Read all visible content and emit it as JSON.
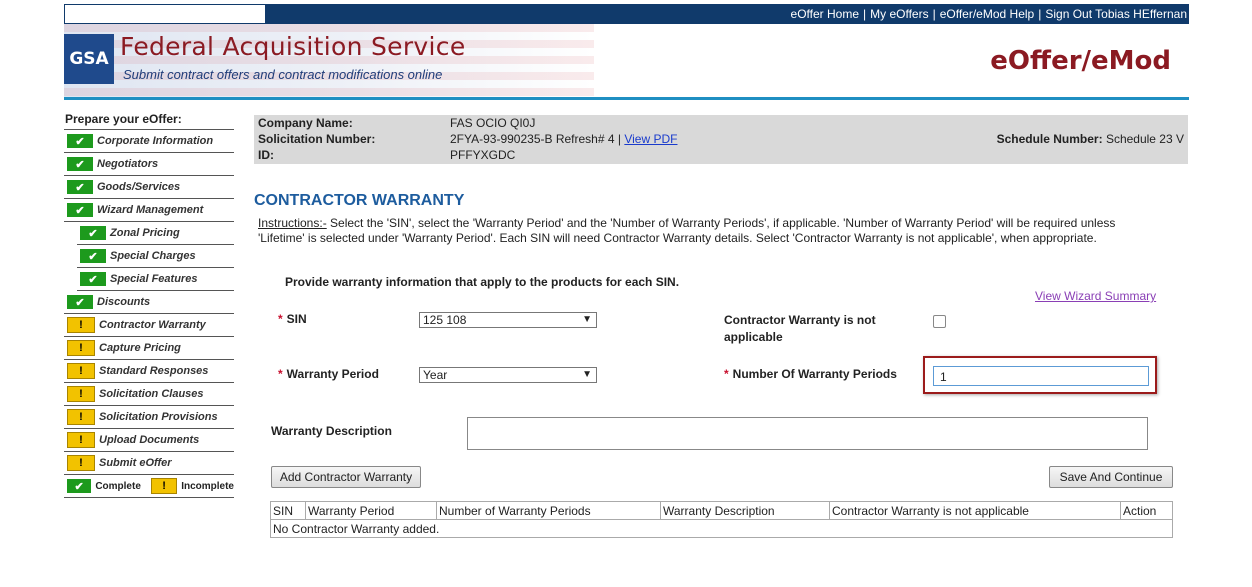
{
  "topnav": {
    "items": [
      "eOffer Home",
      "My eOffers",
      "eOffer/eMod Help",
      "Sign Out Tobias HEffernan"
    ]
  },
  "header": {
    "logo": "GSA",
    "title": "Federal Acquisition Service",
    "subtitle": "Submit contract offers and contract modifications online",
    "app_title": "eOffer/eMod"
  },
  "sidebar": {
    "title": "Prepare your eOffer:",
    "items": [
      {
        "label": "Corporate Information",
        "status": "complete",
        "sub": false
      },
      {
        "label": "Negotiators",
        "status": "complete",
        "sub": false
      },
      {
        "label": "Goods/Services",
        "status": "complete",
        "sub": false
      },
      {
        "label": "Wizard Management",
        "status": "complete",
        "sub": false
      },
      {
        "label": "Zonal Pricing",
        "status": "complete",
        "sub": true
      },
      {
        "label": "Special Charges",
        "status": "complete",
        "sub": true
      },
      {
        "label": "Special Features",
        "status": "complete",
        "sub": true
      },
      {
        "label": "Discounts",
        "status": "complete",
        "sub": false
      },
      {
        "label": "Contractor Warranty",
        "status": "incomplete",
        "sub": false
      },
      {
        "label": "Capture Pricing",
        "status": "incomplete",
        "sub": false
      },
      {
        "label": "Standard Responses",
        "status": "incomplete",
        "sub": false
      },
      {
        "label": "Solicitation Clauses",
        "status": "incomplete",
        "sub": false
      },
      {
        "label": "Solicitation Provisions",
        "status": "incomplete",
        "sub": false
      },
      {
        "label": "Upload Documents",
        "status": "incomplete",
        "sub": false
      },
      {
        "label": "Submit eOffer",
        "status": "incomplete",
        "sub": false
      }
    ],
    "legend": {
      "complete": "Complete",
      "incomplete": "Incomplete"
    }
  },
  "info": {
    "company_label": "Company Name:",
    "company_value": "FAS OCIO QI0J",
    "solicitation_label": "Solicitation Number:",
    "solicitation_value": "2FYA-93-990235-B Refresh# 4 |",
    "view_pdf": "View PDF",
    "id_label": "ID:",
    "id_value": "PFFYXGDC",
    "schedule_label": "Schedule Number:",
    "schedule_value": "Schedule 23 V"
  },
  "main": {
    "title": "CONTRACTOR WARRANTY",
    "instructions_label": "Instructions:-",
    "instructions_text": " Select the 'SIN', select the 'Warranty Period' and the 'Number of Warranty Periods', if applicable. 'Number of Warranty Period' will be required unless 'Lifetime' is selected under 'Warranty Period'. Each SIN will need Contractor Warranty details. Select 'Contractor Warranty is not applicable', when appropriate.",
    "provide_text": "Provide warranty information that apply to the products for each SIN.",
    "wizard_summary_link": "View Wizard Summary",
    "sin_label": "SIN",
    "sin_value": "125 108",
    "not_applicable_label": "Contractor Warranty is not applicable",
    "warranty_period_label": "Warranty Period",
    "warranty_period_value": "Year",
    "num_periods_label": "Number Of Warranty Periods",
    "num_periods_value": "1",
    "description_label": "Warranty Description",
    "add_button": "Add Contractor Warranty",
    "save_button": "Save And Continue"
  },
  "table": {
    "headers": [
      "SIN",
      "Warranty Period",
      "Number of Warranty Periods",
      "Warranty Description",
      "Contractor Warranty is not applicable",
      "Action"
    ],
    "empty_text": "No Contractor Warranty added."
  },
  "colors": {
    "nav_bar": "#103a6b",
    "brand": "#8b1a22",
    "accent_rule": "#1f8fc2",
    "title_blue": "#1d5c9e",
    "complete": "#1d9a1d",
    "incomplete": "#f2c200"
  }
}
